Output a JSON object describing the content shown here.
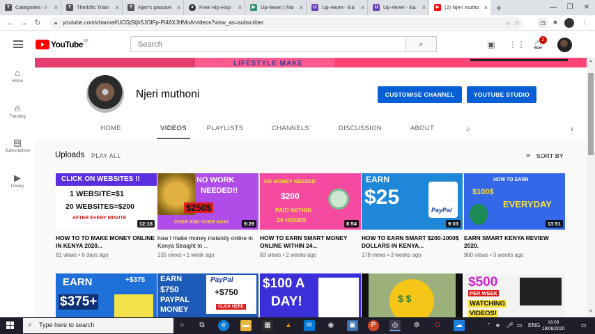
{
  "browser": {
    "tabs": [
      {
        "label": "Categories - I",
        "icon": "page-icon",
        "color": "#555555"
      },
      {
        "label": "Thinkific Train",
        "icon": "page-icon",
        "color": "#555555"
      },
      {
        "label": "Njeri's passive",
        "icon": "page-icon",
        "color": "#555555"
      },
      {
        "label": "Free Hip-Hop",
        "icon": "music-icon",
        "color": "#333333"
      },
      {
        "label": "Up-4ever | Ma",
        "icon": "upload-icon",
        "color": "#2f8f6f"
      },
      {
        "label": "Up-4ever - Ea",
        "icon": "u-icon",
        "color": "#6b3fb8"
      },
      {
        "label": "Up-4ever - Ea",
        "icon": "u-icon",
        "color": "#6b3fb8"
      },
      {
        "label": "(2) Njeri mutho",
        "icon": "youtube-icon",
        "color": "#ff0000"
      }
    ],
    "url": "youtube.com/channel/UCGjStjh5JOIFp-Pi46XJHMoA/videos?view_as=subscriber"
  },
  "masthead": {
    "logo_text": "YouTube",
    "country_code": "KE",
    "search_placeholder": "Search",
    "notification_count": "2"
  },
  "guide": {
    "items": [
      {
        "label": "Home",
        "icon": "home-icon"
      },
      {
        "label": "Trending",
        "icon": "flame-icon"
      },
      {
        "label": "Subscriptions",
        "icon": "subscriptions-icon"
      },
      {
        "label": "Library",
        "icon": "library-icon"
      }
    ]
  },
  "banner": {
    "text": "LIFESTYLE MAKE"
  },
  "channel": {
    "name": "Njeri muthoni",
    "customise_label": "CUSTOMISE CHANNEL",
    "studio_label": "YOUTUBE STUDIO",
    "tabs": [
      "HOME",
      "VIDEOS",
      "PLAYLISTS",
      "CHANNELS",
      "DISCUSSION",
      "ABOUT"
    ],
    "active_tab": "VIDEOS"
  },
  "shelf": {
    "title": "Uploads",
    "play_all": "PLAY ALL",
    "sort_label": "SORT BY"
  },
  "videos": [
    {
      "title": "HOW TO TO MAKE MONEY ONLINE IN KENYA 2020...",
      "views": "81 views",
      "age": "6 days ago",
      "duration": "12:16",
      "thumb_lines": [
        "CLICK ON WEBSITES !!",
        "1 WEBSITE=$1",
        "20 WEBSITES=$200",
        "AFTER EVERY MINUTE"
      ]
    },
    {
      "title": "how I make money instantly online in Kenya Straight to ...",
      "views": "135 views",
      "age": "1 week ago",
      "duration": "9:28",
      "thumb_lines": [
        "NO WORK",
        "NEEDED!!",
        "$250$",
        "OVER AND OVER AGAI"
      ]
    },
    {
      "title": "HOW TO EARN SMART MONEY ONLINE WITHIN 24...",
      "views": "83 views",
      "age": "2 weeks ago",
      "duration": "8:54",
      "thumb_lines": [
        "NO MONEY NEEDED",
        "$200",
        "PAID WITHIN",
        "24 HOURS"
      ]
    },
    {
      "title": "HOW TO EARN SMART $200-1000$ DOLLARS IN KENYA...",
      "views": "178 views",
      "age": "3 weeks ago",
      "duration": "9:03",
      "thumb_lines": [
        "EARN",
        "$25",
        "PayPal"
      ]
    },
    {
      "title": "EARN SMART KENYA REVIEW 2020.",
      "views": "960 views",
      "age": "3 weeks ago",
      "duration": "13:51",
      "thumb_lines": [
        "HOW TO EARN",
        "$100$",
        "EVERYDAY"
      ]
    },
    {
      "title": "",
      "views": "",
      "age": "",
      "duration": "",
      "thumb_lines": [
        "EARN",
        "+$375",
        "$375+"
      ]
    },
    {
      "title": "",
      "views": "",
      "age": "",
      "duration": "",
      "thumb_lines": [
        "EARN",
        "$750",
        "PAYPAL",
        "MONEY",
        "PayPal",
        "+$750",
        "CLICK HERE"
      ]
    },
    {
      "title": "",
      "views": "",
      "age": "",
      "duration": "",
      "thumb_lines": [
        "$100 A",
        "DAY!"
      ]
    },
    {
      "title": "",
      "views": "",
      "age": "",
      "duration": "",
      "thumb_lines": []
    },
    {
      "title": "",
      "views": "",
      "age": "",
      "duration": "",
      "thumb_lines": [
        "$500",
        "PER WEEK",
        "WATCHING",
        "VIDEOS!"
      ]
    }
  ],
  "taskbar": {
    "search_placeholder": "Type here to search",
    "language": "ENG",
    "time": "16:09",
    "date": "18/08/2020"
  },
  "colors": {
    "youtube_red": "#ff0000",
    "studio_blue": "#065fd4",
    "taskbar": "#1f1f2b"
  }
}
